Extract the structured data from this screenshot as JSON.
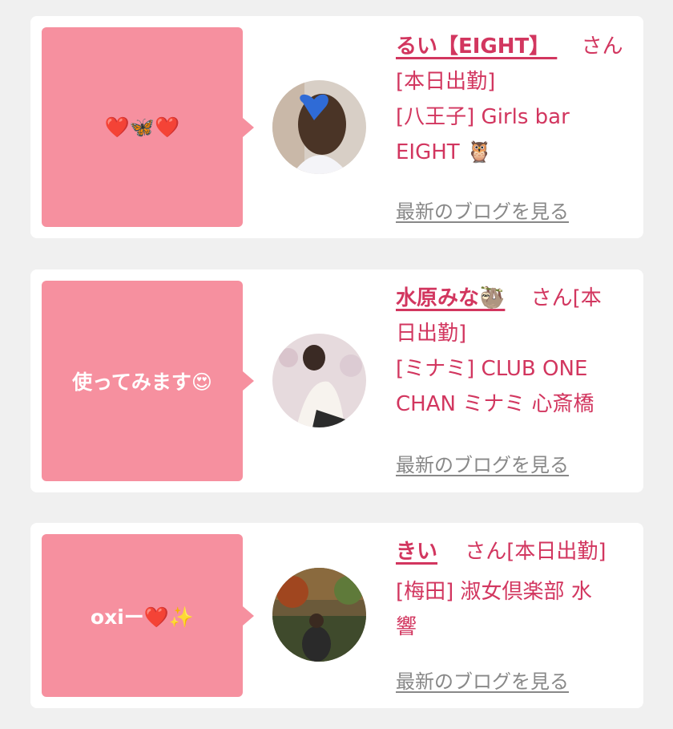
{
  "cards": [
    {
      "message": "❤️🦋❤️",
      "name": "るい【EIGHT】 ",
      "honorific": "さん",
      "line1": "[本日出勤]",
      "line2": "[八王子] Girls bar",
      "line3": "EIGHT 🦉",
      "blog_link": "最新のブログを見る"
    },
    {
      "message": "使ってみます😍",
      "name": "水原みな🦥",
      "honorific": "さん[本",
      "line1": "日出勤]",
      "line2": "[ミナミ] CLUB ONE",
      "line3": "CHAN ミナミ 心斎橋",
      "blog_link": "最新のブログを見る"
    },
    {
      "message": "oxiー❤️✨",
      "name": "きい",
      "honorific": "さん[本日出勤]",
      "line1": "[梅田] 淑女倶楽部 水",
      "line2": "響",
      "blog_link": "最新のブログを見る"
    }
  ],
  "colors": {
    "accent": "#d2365f",
    "bubble": "#f6909f",
    "link": "#888888",
    "background": "#f0f0f0"
  }
}
